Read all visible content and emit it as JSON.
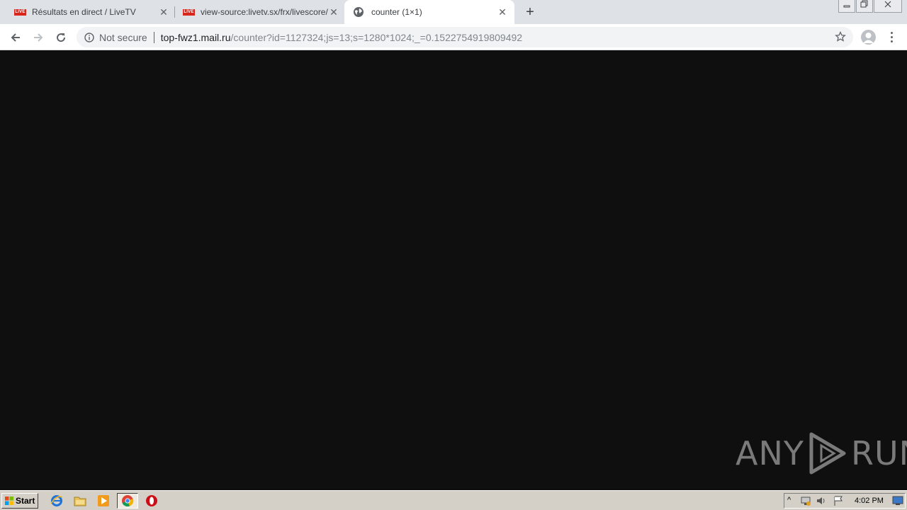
{
  "browser": {
    "tabs": [
      {
        "title": "Résultats en direct / LiveTV",
        "badge": "LIVE",
        "active": false
      },
      {
        "title": "view-source:livetv.sx/frx/livescore/",
        "badge": "LIVE",
        "active": false
      },
      {
        "title": "counter (1×1)",
        "icon": "globe-icon",
        "active": true
      }
    ],
    "new_tab_label": "+",
    "close_glyph": "✕"
  },
  "toolbar": {
    "security_label": "Not secure",
    "url_host": "top-fwz1.mail.ru",
    "url_path": "/counter?id=1127324;js=13;s=1280*1024;_=0.1522754919809492"
  },
  "watermark": {
    "left": "ANY",
    "right": "RUN"
  },
  "taskbar": {
    "start_label": "Start",
    "clock": "4:02 PM",
    "apps": [
      "internet-explorer-icon",
      "file-explorer-icon",
      "media-player-icon",
      "chrome-icon",
      "opera-icon"
    ]
  },
  "colors": {
    "live_badge": "#d8261c",
    "content_bg": "#0f0f0f",
    "tabstrip_bg": "#dee1e6"
  }
}
